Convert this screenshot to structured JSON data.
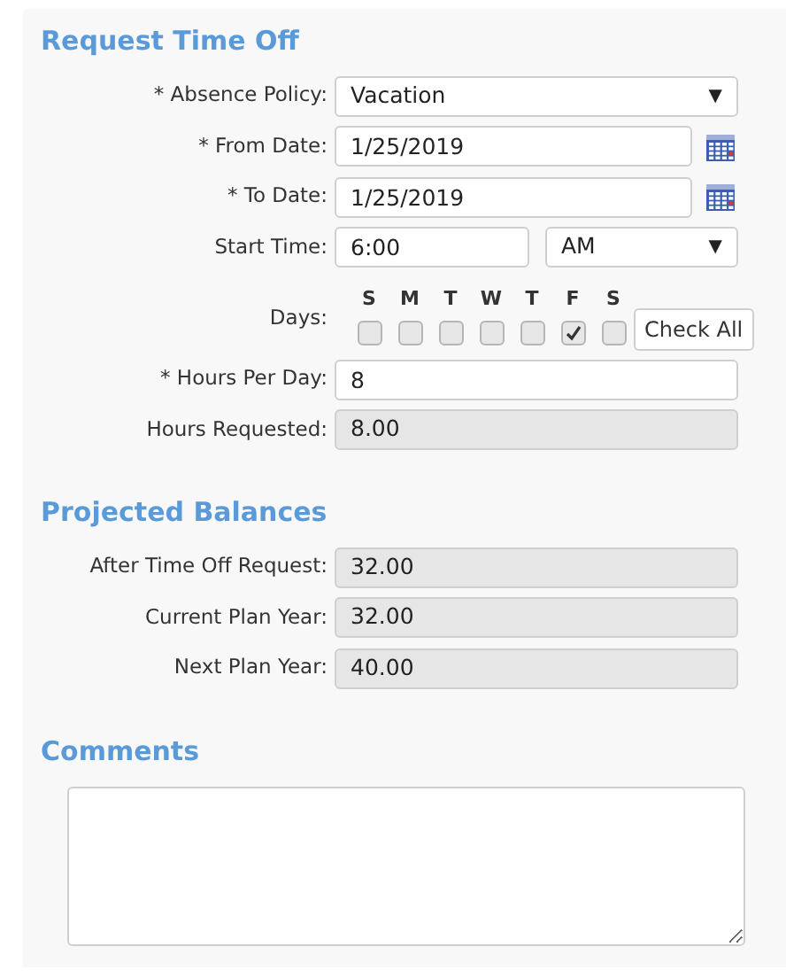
{
  "request": {
    "title": "Request Time Off",
    "fields": [
      {
        "kind": "select",
        "label": "* Absence Policy:",
        "value": "Vacation",
        "caret": "▼"
      },
      {
        "kind": "date",
        "label": "* From Date:",
        "value": "1/25/2019"
      },
      {
        "kind": "date",
        "label": "* To Date:",
        "value": "1/25/2019"
      },
      {
        "kind": "time",
        "label": "Start Time:",
        "value": "6:00",
        "period": "AM",
        "caret": "▼"
      },
      {
        "kind": "days",
        "label": "Days:",
        "days": [
          {
            "letter": "S",
            "checked": false
          },
          {
            "letter": "M",
            "checked": false
          },
          {
            "letter": "T",
            "checked": false
          },
          {
            "letter": "W",
            "checked": false
          },
          {
            "letter": "T",
            "checked": false
          },
          {
            "letter": "F",
            "checked": true
          },
          {
            "letter": "S",
            "checked": false
          }
        ],
        "button": "Check All"
      },
      {
        "kind": "text",
        "label": "* Hours Per Day:",
        "value": "8"
      },
      {
        "kind": "readonly",
        "label": "Hours Requested:",
        "value": "8.00"
      }
    ]
  },
  "balances": {
    "title": "Projected Balances",
    "fields": [
      {
        "kind": "readonly",
        "label": "After Time Off Request:",
        "value": "32.00"
      },
      {
        "kind": "readonly",
        "label": "Current Plan Year:",
        "value": "32.00"
      },
      {
        "kind": "readonly",
        "label": "Next Plan Year:",
        "value": "40.00"
      }
    ]
  },
  "comments": {
    "title": "Comments"
  }
}
